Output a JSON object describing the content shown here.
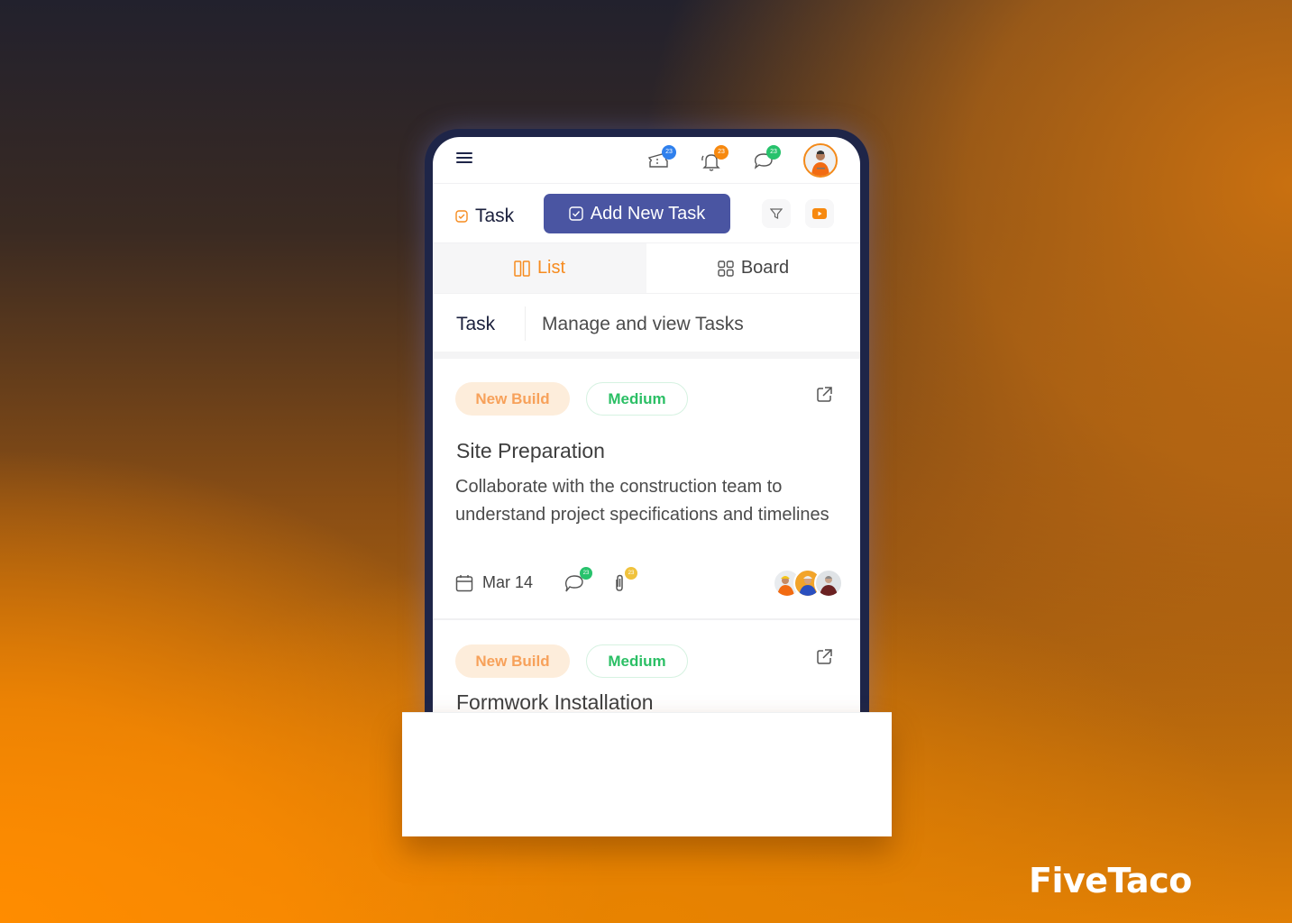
{
  "topbar": {
    "menu_icon": "hamburger-icon",
    "icons": [
      {
        "name": "ticket-icon",
        "badge": "23",
        "badge_color": "#2f80ed"
      },
      {
        "name": "bell-icon",
        "badge": "23",
        "badge_color": "#f7890f"
      },
      {
        "name": "chat-icon",
        "badge": "23",
        "badge_color": "#27c26c"
      }
    ],
    "avatar": "user-avatar"
  },
  "header": {
    "title": "Task",
    "add_button_label": "Add New Task",
    "filter_icon": "filter-icon",
    "video_icon": "youtube-icon"
  },
  "tabs": [
    {
      "label": "List",
      "icon": "columns-icon",
      "active": true
    },
    {
      "label": "Board",
      "icon": "grid-icon",
      "active": false
    }
  ],
  "section": {
    "title": "Task",
    "subtitle": "Manage and view Tasks"
  },
  "cards": [
    {
      "category": "New Build",
      "priority": "Medium",
      "title": "Site Preparation",
      "description": "Collaborate with the construction team to understand project specifications and timelines",
      "date": "Mar 14",
      "comments_badge": "23",
      "attachments_badge": "23",
      "assignees": 3
    },
    {
      "category": "New Build",
      "priority": "Medium",
      "title": "Formwork Installation"
    }
  ],
  "colors": {
    "accent_orange": "#f68b1f",
    "primary_button": "#4a55a2",
    "priority_green": "#2bbf65",
    "category_bg": "#fdeddb",
    "comment_badge": "#27c26c",
    "attachment_badge": "#f0c23c"
  },
  "brand": "FiveTaco"
}
